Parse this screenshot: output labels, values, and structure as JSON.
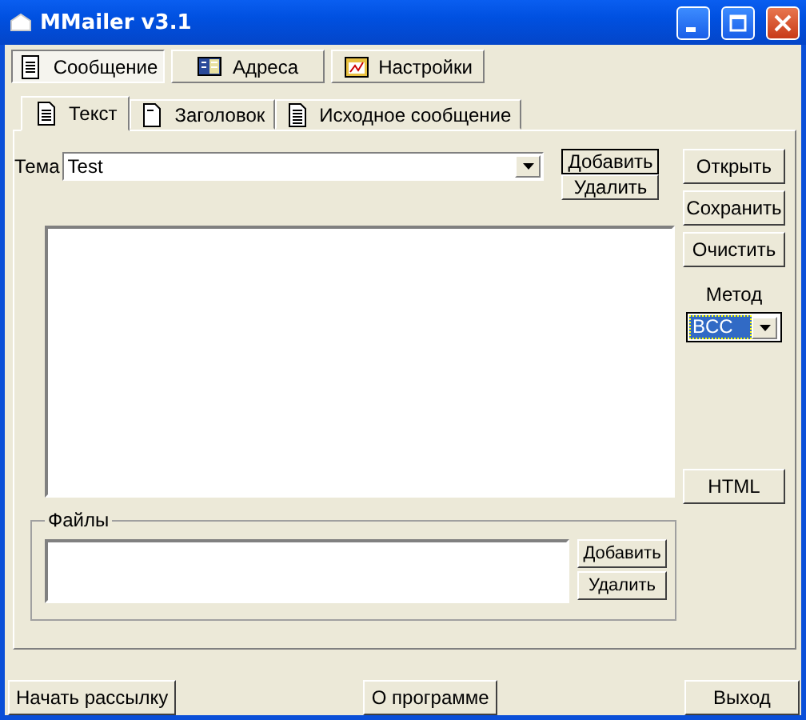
{
  "window": {
    "title": "MMailer v3.1"
  },
  "main_tabs": [
    {
      "label": "Сообщение",
      "selected": true
    },
    {
      "label": "Адреса",
      "selected": false
    },
    {
      "label": "Настройки",
      "selected": false
    }
  ],
  "sub_tabs": [
    {
      "label": "Текст",
      "selected": true
    },
    {
      "label": "Заголовок",
      "selected": false
    },
    {
      "label": "Исходное сообщение",
      "selected": false
    }
  ],
  "subject": {
    "label": "Тема",
    "value": "Test",
    "buttons": [
      "Добавить",
      "Удалить"
    ]
  },
  "side_buttons": [
    "Открыть",
    "Сохранить",
    "Очистить"
  ],
  "method": {
    "label": "Метод",
    "value": "BCC"
  },
  "html_button": "HTML",
  "files": {
    "label": "Файлы",
    "buttons": [
      "Добавить",
      "Удалить"
    ]
  },
  "bottom_buttons": [
    "Начать рассылку",
    "О программе",
    "Выход"
  ]
}
